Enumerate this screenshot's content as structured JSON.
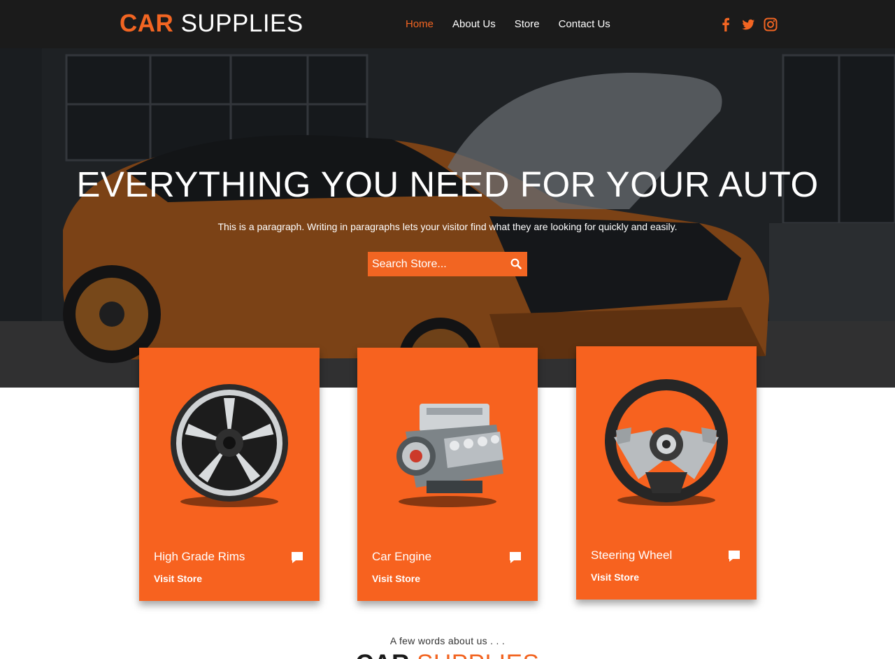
{
  "brand": {
    "accent": "CAR",
    "main": "SUPPLIES"
  },
  "colors": {
    "accent": "#f26522",
    "header_bg": "#1b1b1b",
    "card_bg": "#f7621f"
  },
  "nav": {
    "items": [
      {
        "label": "Home",
        "active": true
      },
      {
        "label": "About Us",
        "active": false
      },
      {
        "label": "Store",
        "active": false
      },
      {
        "label": "Contact Us",
        "active": false
      }
    ]
  },
  "social": [
    "facebook-icon",
    "twitter-icon",
    "instagram-icon"
  ],
  "hero": {
    "title": "EVERYTHING YOU NEED FOR YOUR AUTO",
    "paragraph": "This is a paragraph. Writing in paragraphs lets your visitor find what they are looking for quickly and easily.",
    "search": {
      "placeholder": "Search Store...",
      "icon": "search-icon"
    }
  },
  "cards": [
    {
      "title": "High Grade Rims",
      "link": "Visit Store",
      "image": "rim-image"
    },
    {
      "title": "Car Engine",
      "link": "Visit Store",
      "image": "engine-image"
    },
    {
      "title": "Steering Wheel",
      "link": "Visit Store",
      "image": "steering-wheel-image"
    }
  ],
  "about": {
    "kicker": "A few words about us . . .",
    "logo": {
      "accent": "CAR",
      "main": "SUPPLIES"
    }
  }
}
